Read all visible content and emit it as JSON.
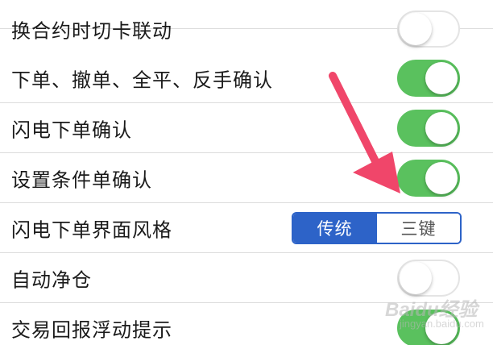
{
  "settings": [
    {
      "label": "换合约时切卡联动",
      "state": "off"
    },
    {
      "label": "下单、撤单、全平、反手确认",
      "state": "on"
    },
    {
      "label": "闪电下单确认",
      "state": "on"
    },
    {
      "label": "设置条件单确认",
      "state": "on"
    },
    {
      "label": "闪电下单界面风格",
      "control": "segmented",
      "options": [
        "传统",
        "三键"
      ],
      "selected": "传统"
    },
    {
      "label": "自动净仓",
      "state": "off"
    },
    {
      "label": "交易回报浮动提示",
      "state": "on"
    }
  ],
  "watermark": {
    "logo": "Baidu经验",
    "url": "jingyan.baidu.com"
  },
  "colors": {
    "toggle_on": "#5ac15e",
    "toggle_off_border": "#e4e4e4",
    "segment_accent": "#2d63c8",
    "arrow": "#f0466a",
    "divider": "#dcdcdc"
  }
}
